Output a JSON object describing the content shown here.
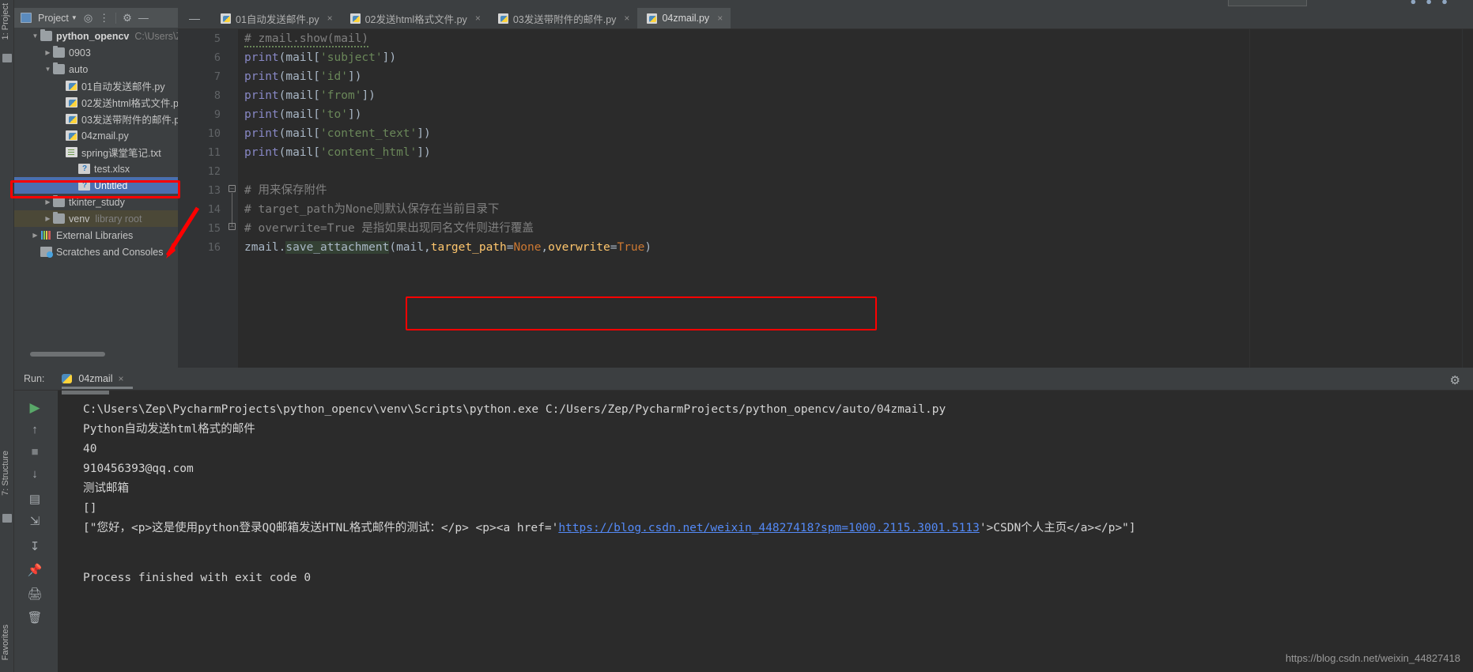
{
  "window": {
    "tool_rail": {
      "project_label": "1: Project",
      "structure_label": "7: Structure",
      "favorites_label": "Favorites"
    }
  },
  "project_panel": {
    "title": "Project",
    "icons": [
      "project-window-icon",
      "locate-icon",
      "collapse-all-icon",
      "settings-gear-icon",
      "hide-icon"
    ],
    "tree": [
      {
        "label": "python_opencv",
        "hint": "C:\\Users\\Z",
        "icon": "folder",
        "state": "open",
        "indent": 0,
        "bold": true,
        "selected": false
      },
      {
        "label": "0903",
        "hint": "",
        "icon": "folder",
        "state": "closed",
        "indent": 1,
        "bold": false,
        "selected": false
      },
      {
        "label": "auto",
        "hint": "",
        "icon": "folder",
        "state": "open",
        "indent": 1,
        "bold": false,
        "selected": false
      },
      {
        "label": "01自动发送邮件.py",
        "hint": "",
        "icon": "py",
        "state": "none",
        "indent": 2,
        "bold": false,
        "selected": false
      },
      {
        "label": "02发送html格式文件.p",
        "hint": "",
        "icon": "py",
        "state": "none",
        "indent": 2,
        "bold": false,
        "selected": false
      },
      {
        "label": "03发送带附件的邮件.p",
        "hint": "",
        "icon": "py",
        "state": "none",
        "indent": 2,
        "bold": false,
        "selected": false
      },
      {
        "label": "04zmail.py",
        "hint": "",
        "icon": "py",
        "state": "none",
        "indent": 2,
        "bold": false,
        "selected": false
      },
      {
        "label": "spring课堂笔记.txt",
        "hint": "",
        "icon": "txt",
        "state": "none",
        "indent": 2,
        "bold": false,
        "selected": false
      },
      {
        "label": "test.xlsx",
        "hint": "",
        "icon": "unknown",
        "state": "none",
        "indent": 3,
        "bold": false,
        "selected": false
      },
      {
        "label": "Untitled",
        "hint": "",
        "icon": "unknown",
        "state": "none",
        "indent": 3,
        "bold": false,
        "selected": true
      },
      {
        "label": "tkinter_study",
        "hint": "",
        "icon": "folder",
        "state": "closed",
        "indent": 1,
        "bold": false,
        "selected": false
      },
      {
        "label": "venv",
        "hint": "library root",
        "icon": "folder",
        "state": "closed",
        "indent": 1,
        "bold": false,
        "selected": false
      },
      {
        "label": "External Libraries",
        "hint": "",
        "icon": "lib",
        "state": "closed",
        "indent": 0,
        "bold": false,
        "selected": false
      },
      {
        "label": "Scratches and Consoles",
        "hint": "",
        "icon": "scratch",
        "state": "none",
        "indent": 0,
        "bold": false,
        "selected": false
      }
    ]
  },
  "editor": {
    "tabs": [
      {
        "label": "01自动发送邮件.py",
        "active": false
      },
      {
        "label": "02发送html格式文件.py",
        "active": false
      },
      {
        "label": "03发送带附件的邮件.py",
        "active": false
      },
      {
        "label": "04zmail.py",
        "active": true
      }
    ],
    "close_glyph": "×",
    "hide_glyph": "—",
    "line_numbers": [
      "5",
      "6",
      "7",
      "8",
      "9",
      "10",
      "11",
      "12",
      "13",
      "14",
      "15",
      "16"
    ],
    "lines": [
      {
        "n": "5",
        "kind": "comment",
        "text": "# zmail.show(mail)"
      },
      {
        "n": "6",
        "kind": "code",
        "func": "print",
        "arg_pre": "(mail[",
        "str": "'subject'",
        "arg_post": "])"
      },
      {
        "n": "7",
        "kind": "code",
        "func": "print",
        "arg_pre": "(mail[",
        "str": "'id'",
        "arg_post": "])"
      },
      {
        "n": "8",
        "kind": "code",
        "func": "print",
        "arg_pre": "(mail[",
        "str": "'from'",
        "arg_post": "])"
      },
      {
        "n": "9",
        "kind": "code",
        "func": "print",
        "arg_pre": "(mail[",
        "str": "'to'",
        "arg_post": "])"
      },
      {
        "n": "10",
        "kind": "code",
        "func": "print",
        "arg_pre": "(mail[",
        "str": "'content_text'",
        "arg_post": "])"
      },
      {
        "n": "11",
        "kind": "code",
        "func": "print",
        "arg_pre": "(mail[",
        "str": "'content_html'",
        "arg_post": "])"
      },
      {
        "n": "12",
        "kind": "blank",
        "text": ""
      },
      {
        "n": "13",
        "kind": "comment",
        "text": "# 用来保存附件"
      },
      {
        "n": "14",
        "kind": "comment",
        "text": "# target_path为None则默认保存在当前目录下"
      },
      {
        "n": "15",
        "kind": "comment",
        "text": "# overwrite=True 是指如果出现同名文件则进行覆盖"
      },
      {
        "n": "16",
        "kind": "call",
        "obj": "zmail.",
        "method": "save_attachment",
        "open": "(",
        "a1": "mail",
        "c1": ",",
        "kw1": "target_path",
        "eq1": "=",
        "v1": "None",
        "c2": ",",
        "kw2": "overwrite",
        "eq2": "=",
        "v2": "True",
        "close": ")"
      }
    ],
    "highlight_color": "#ff0000"
  },
  "run_panel": {
    "title": "Run:",
    "tab_label": "04zmail",
    "close_glyph": "×",
    "gear_icon": "settings-gear-icon",
    "side_buttons": [
      "run-icon",
      "rerun-up-icon",
      "stop-icon",
      "scroll-down-icon",
      "soft-wrap-icon",
      "show-history-icon",
      "scroll-to-end-icon",
      "print-icon",
      "clear-all-icon",
      "pin-icon"
    ],
    "console_lines": [
      {
        "type": "plain",
        "text": "C:\\Users\\Zep\\PycharmProjects\\python_opencv\\venv\\Scripts\\python.exe C:/Users/Zep/PycharmProjects/python_opencv/auto/04zmail.py"
      },
      {
        "type": "plain",
        "text": "Python自动发送html格式的邮件"
      },
      {
        "type": "plain",
        "text": "40"
      },
      {
        "type": "plain",
        "text": "910456393@qq.com"
      },
      {
        "type": "plain",
        "text": "测试邮箱"
      },
      {
        "type": "plain",
        "text": "[]"
      },
      {
        "type": "link",
        "pre": "[\"您好，<p>这是使用python登录QQ邮箱发送HTNL格式邮件的测试：</p> <p><a href='",
        "url": "https://blog.csdn.net/weixin_44827418?spm=1000.2115.3001.5113",
        "post": "'>CSDN个人主页</a></p>\"]"
      },
      {
        "type": "blank",
        "text": ""
      },
      {
        "type": "plain",
        "text": "Process finished with exit code 0"
      }
    ]
  },
  "watermark": "https://blog.csdn.net/weixin_44827418"
}
